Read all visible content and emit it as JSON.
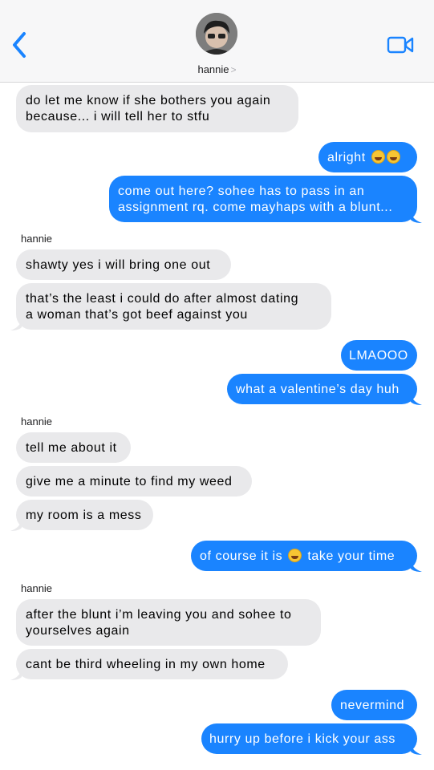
{
  "header": {
    "contact_name": "hannie",
    "chevron": ">"
  },
  "icons": {
    "back": "chevron-left-icon",
    "video": "video-camera-icon",
    "avatar": "contact-avatar"
  },
  "colors": {
    "outgoing": "#1a84ff",
    "incoming": "#e9e9eb"
  },
  "messages": {
    "m1": {
      "line1": "do let me know if she bothers you again",
      "line2": "because... i will tell her to stfu"
    },
    "m2": "alright",
    "m3": {
      "line1": "come out here? sohee has to pass in an",
      "line2": "assignment rq. come mayhaps with a blunt..."
    },
    "sender1": "hannie",
    "m4": "shawty yes i will bring one out",
    "m5": {
      "line1": "that’s the least i could do after almost dating",
      "line2": "a woman that’s got beef against you"
    },
    "m6": "LMAOOO",
    "m7": "what a valentine’s day huh",
    "sender2": "hannie",
    "m8": "tell me about it",
    "m9": "give me a minute to find my weed",
    "m10": "my room is a mess",
    "m11": {
      "before": "of course it is",
      "after": "take your time"
    },
    "sender3": "hannie",
    "m12": {
      "line1": "after the blunt i’m leaving you and sohee to",
      "line2": "yourselves again"
    },
    "m13": "cant be third wheeling in my own home",
    "m14": "nevermind",
    "m15": "hurry up before i kick your ass"
  }
}
